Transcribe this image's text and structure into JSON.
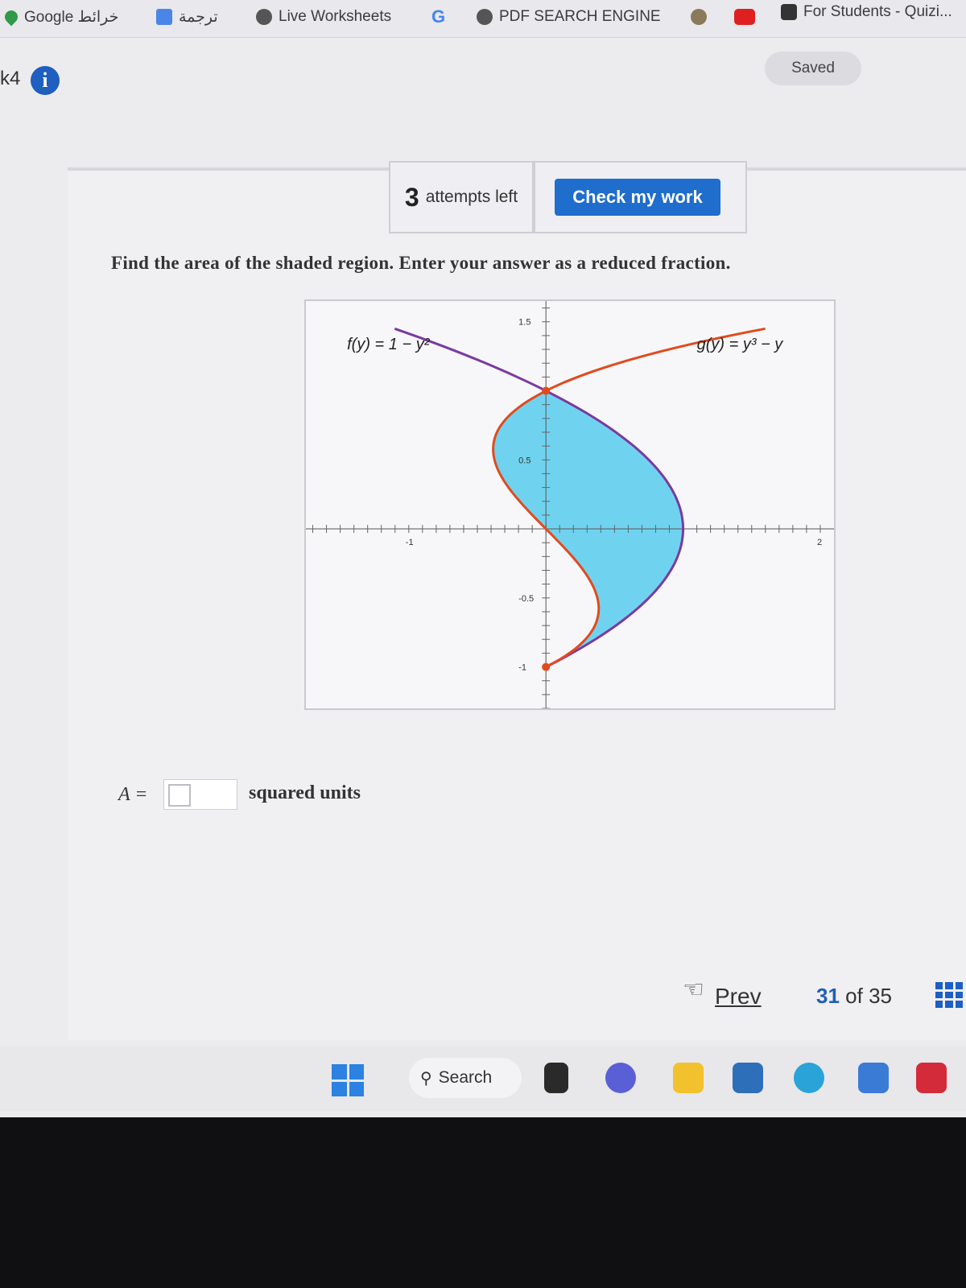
{
  "bookmarks": [
    {
      "label": "Google خرائط",
      "icon": "map-pin-icon"
    },
    {
      "label": "ترجمة",
      "icon": "translate-icon"
    },
    {
      "label": "Live Worksheets",
      "icon": "globe-icon"
    },
    {
      "label": "",
      "icon": "google-g-icon"
    },
    {
      "label": "PDF SEARCH ENGINE",
      "icon": "globe-icon"
    },
    {
      "label": "",
      "icon": "emblem-icon"
    },
    {
      "label": "",
      "icon": "youtube-icon"
    },
    {
      "label": "For Students - Quizi...",
      "icon": "quizizz-icon"
    }
  ],
  "header": {
    "kb_label": "k4",
    "info_glyph": "i",
    "saved_label": "Saved"
  },
  "toolbar": {
    "attempts_count": "3",
    "attempts_text": "attempts left",
    "check_label": "Check my work"
  },
  "question": {
    "prompt": "Find the area of the shaded region. Enter your answer as a reduced fraction."
  },
  "chart_data": {
    "type": "line",
    "title": "",
    "xlabel": "",
    "ylabel": "",
    "xlim": [
      -1.75,
      2.1
    ],
    "ylim": [
      -1.3,
      1.65
    ],
    "x_ticks_labeled": [
      "-1",
      "2"
    ],
    "y_ticks_labeled": [
      "1.5",
      "0.5",
      "-0.5",
      "-1"
    ],
    "series": [
      {
        "name": "f(y) = 1 − y²",
        "color": "#7a3aa0",
        "y_range": [
          -1,
          1.45
        ]
      },
      {
        "name": "g(y) = y³ − y",
        "color": "#e24a1d",
        "y_range": [
          -1,
          1.45
        ]
      }
    ],
    "intersections": [
      [
        0,
        1
      ],
      [
        0,
        -1
      ]
    ],
    "shaded_between": [
      -1,
      1
    ],
    "shade_color": "#6fd3f0",
    "grid": false
  },
  "answer": {
    "label": "A =",
    "value": "",
    "units": "squared units"
  },
  "pagination": {
    "prev_label": "Prev",
    "current": "31",
    "of_text": "of",
    "total": "35"
  },
  "taskbar": {
    "search_label": "Search"
  }
}
